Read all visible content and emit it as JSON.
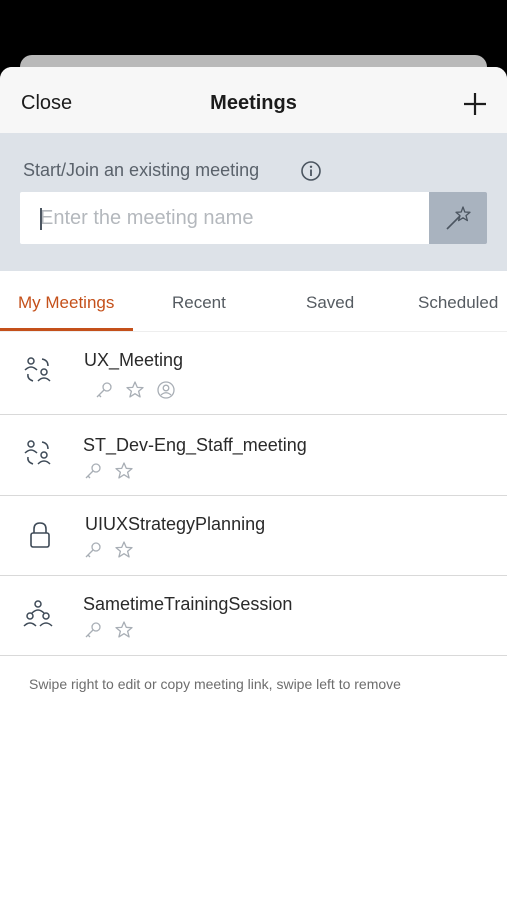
{
  "nav": {
    "close_label": "Close",
    "title": "Meetings",
    "add_icon": "plus-icon"
  },
  "join": {
    "label": "Start/Join an existing meeting",
    "info_icon": "info-icon",
    "input_value": "",
    "input_placeholder": "Enter the meeting name",
    "go_icon": "magic-wand-icon"
  },
  "tabs": [
    {
      "label": "My Meetings",
      "active": true
    },
    {
      "label": "Recent",
      "active": false
    },
    {
      "label": "Saved",
      "active": false
    },
    {
      "label": "Scheduled",
      "active": false
    }
  ],
  "meetings": [
    {
      "name": "UX_Meeting",
      "icon": "people-group-icon",
      "badges": [
        "key-icon",
        "star-icon",
        "person-circle-icon"
      ]
    },
    {
      "name": "ST_Dev-Eng_Staff_meeting",
      "icon": "people-group-icon",
      "badges": [
        "key-icon",
        "star-icon"
      ]
    },
    {
      "name": "UIUXStrategyPlanning",
      "icon": "lock-icon",
      "badges": [
        "key-icon",
        "star-icon"
      ]
    },
    {
      "name": "SametimeTrainingSession",
      "icon": "three-people-icon",
      "badges": [
        "key-icon",
        "star-icon"
      ]
    }
  ],
  "hint": "Swipe right to edit or copy meeting link, swipe left to remove",
  "colors": {
    "accent": "#c4501a",
    "join_bg": "#dde2e8",
    "join_button_bg": "#a9b3bf"
  }
}
